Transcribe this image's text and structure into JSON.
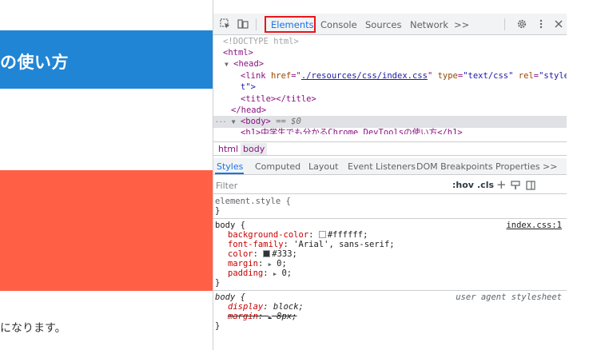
{
  "page": {
    "header_title": "の使い方",
    "footer_text": "になります。",
    "colors": {
      "header": "#2185d5",
      "orange": "#ff5f45"
    }
  },
  "devtools": {
    "tabs": [
      {
        "label": "Elements",
        "active": true
      },
      {
        "label": "Console"
      },
      {
        "label": "Sources"
      },
      {
        "label": "Network"
      },
      {
        "label": ">>"
      }
    ],
    "icons": [
      "inspect-element-icon",
      "device-toolbar-icon",
      "settings-gear-icon",
      "kebab-menu-icon",
      "close-icon"
    ],
    "dom": {
      "doctype": "<!DOCTYPE html>",
      "html_open": "<html>",
      "head_open": "<head>",
      "link_tag": "<link",
      "link_href_attr": "href",
      "link_href_val": "./resources/css/index.css",
      "link_type_attr": "type",
      "link_type_val": "\"text/css\"",
      "link_rel_attr": "rel",
      "link_rel_val": "\"styleshee",
      "link_cont": "t\">",
      "title_tag": "<title></title>",
      "head_close": "</head>",
      "body_open": "<body>",
      "body_eq": "== $0",
      "h1_line": "<h1>中学生でも分かるChrome DevToolsの使い方</h1>"
    },
    "breadcrumbs": [
      "html",
      "body"
    ],
    "subtabs": [
      {
        "label": "Styles",
        "active": true
      },
      {
        "label": "Computed"
      },
      {
        "label": "Layout"
      },
      {
        "label": "Event Listeners"
      },
      {
        "label": "DOM Breakpoints"
      },
      {
        "label": "Properties"
      },
      {
        "label": ">>"
      }
    ],
    "filter": {
      "placeholder": "Filter",
      "hov": ":hov",
      "cls": ".cls",
      "plus": "+"
    },
    "rules": {
      "element_style_open": "element.style {",
      "close": "}",
      "body1_selector": "body {",
      "body1_source": "index.css:1",
      "body1_props": [
        {
          "name": "background-color",
          "value": "#ffffff",
          "swatch": "#ffffff"
        },
        {
          "name": "font-family",
          "value": "'Arial', sans-serif;"
        },
        {
          "name": "color",
          "value": "#333;",
          "swatch": "#333333"
        },
        {
          "name": "margin",
          "value": "0;"
        },
        {
          "name": "padding",
          "value": "0;"
        }
      ],
      "body2_selector": "body {",
      "body2_source": "user agent stylesheet",
      "body2_props": [
        {
          "name": "display",
          "value": "block;"
        },
        {
          "name": "margin",
          "value": "8px;"
        }
      ]
    }
  }
}
